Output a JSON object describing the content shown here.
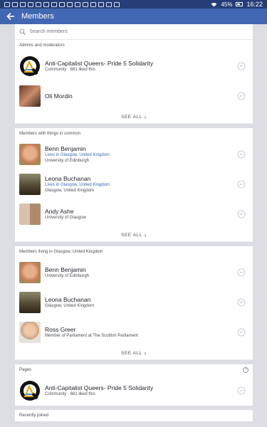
{
  "status_bar": {
    "battery": "45%",
    "time": "16:22"
  },
  "app_bar": {
    "title": "Members"
  },
  "search": {
    "placeholder": "Search members"
  },
  "sections": {
    "admins": {
      "title": "Admins and moderators",
      "see_all": "SEE ALL",
      "members": [
        {
          "name": "Anti-Capitalist Queers- Pride 5 Solidarity",
          "lines": [
            "Community · 681 liked this"
          ]
        },
        {
          "name": "Oli Mordin",
          "lines": []
        }
      ]
    },
    "common": {
      "title": "Members with things in common",
      "see_all": "SEE ALL",
      "members": [
        {
          "name": "Benn Benjamin",
          "line1": "Lives in Glasgow, United Kingdom",
          "line2": "University of Edinburgh"
        },
        {
          "name": "Leona Buchanan",
          "line1": "Lives in Glasgow, United Kingdom",
          "line2": "Glasgow, United Kingdom"
        },
        {
          "name": "Andy Ashe",
          "line1": "University of Glasgow"
        }
      ]
    },
    "living": {
      "title": "Members living in Glasgow, United Kingdom",
      "see_all": "SEE ALL",
      "members": [
        {
          "name": "Benn Benjamin",
          "line1": "University of Edinburgh"
        },
        {
          "name": "Leona Buchanan",
          "line1": "Glasgow, United Kingdom"
        },
        {
          "name": "Ross Greer",
          "line1": "Member of Parliament at The Scottish Parliament"
        }
      ]
    },
    "pages": {
      "title": "Pages",
      "help": "?",
      "members": [
        {
          "name": "Anti-Capitalist Queers- Pride 5 Solidarity",
          "line1": "Community · 681 liked this"
        }
      ]
    },
    "recent": {
      "title": "Recently joined"
    }
  },
  "colors": {
    "brand": "#4267b2",
    "status_bar": "#253e78",
    "link": "#4267b2"
  }
}
